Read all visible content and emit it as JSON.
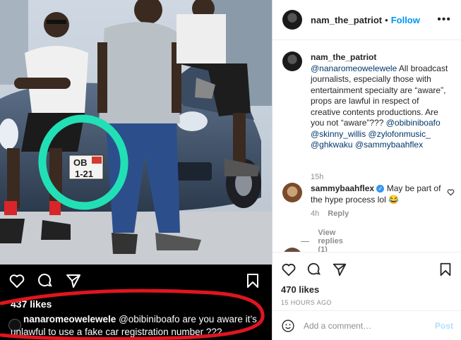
{
  "post_image": {
    "plate_text": [
      "OB",
      "1-21"
    ],
    "likes_label": "437 likes",
    "caption_user": "nanaromeowelewele",
    "caption_text": "@obibiniboafo are you aware it’s unlawful to use a fake car registration number ???"
  },
  "header": {
    "username": "nam_the_patriot",
    "separator": "•",
    "follow_label": "Follow",
    "more_label": "•••"
  },
  "comments": [
    {
      "username": "nam_the_patriot",
      "text_before": "",
      "mention_lead": "@nanaromeowelewele",
      "body": " All broadcast journalists, especially those with entertainment specialty are “aware”, props are lawful in respect of creative contents productions. Are you not “aware”??? ",
      "mentions_tail": "@obibiniboafo @skinny_willis @zylofonmusic_ @ghkwaku @sammybaahflex",
      "time": "15h"
    },
    {
      "username": "sammybaahflex",
      "verified_icon": "verified-badge-icon",
      "body": " May be part of the hype process lol 😂",
      "time": "4h",
      "reply_label": "Reply",
      "view_replies_label": "View replies (1)"
    }
  ],
  "actions": {
    "likes_label": "470 likes",
    "time_ago": "15 HOURS AGO"
  },
  "add_comment": {
    "placeholder": "Add a comment…",
    "post_label": "Post"
  },
  "colors": {
    "link": "#00376b",
    "follow": "#0095f6",
    "post_disabled": "#b2dffc",
    "highlight_ring": "#22e0b5",
    "red_scribble": "#e0151f"
  }
}
